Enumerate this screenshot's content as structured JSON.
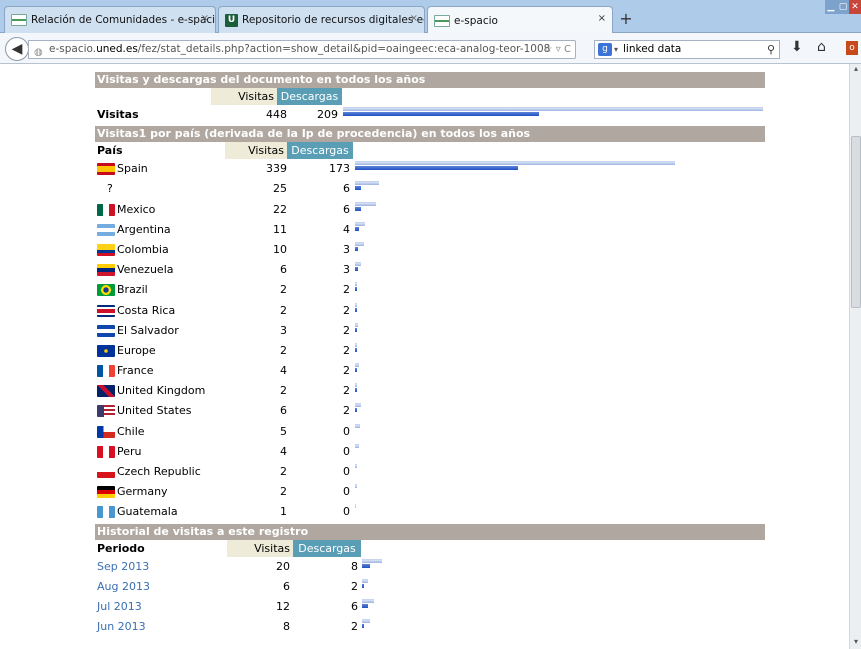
{
  "browser": {
    "tabs": [
      {
        "label": "Relación de Comunidades - e-spacio",
        "icon": "uned-favicon"
      },
      {
        "label": "Repositorio de recursos digitales edu...",
        "icon": "u-favicon"
      },
      {
        "label": "e-spacio",
        "icon": "uned-favicon"
      }
    ],
    "url_prefix": "e-spacio.",
    "url_domain": "uned.es",
    "url_suffix": "/fez/stat_details.php?action=show_detail&pid=oaingeec:eca-analog-teor-1008",
    "search_value": "linked data",
    "new_tab_glyph": "+",
    "close_tab_glyph": "×"
  },
  "section1": {
    "title": "Visitas y descargas del documento en todos los años",
    "col_visits": "Visitas",
    "col_downloads": "Descargas",
    "row_label": "Visitas",
    "visits": 448,
    "downloads": 209
  },
  "section2": {
    "title": "Visitas1 por país (derivada de la Ip de procedencia) en todos los años",
    "col_label": "País",
    "col_visits": "Visitas",
    "col_downloads": "Descargas",
    "rows": [
      {
        "country": "Spain",
        "visits": 339,
        "downloads": 173,
        "flag": "spain"
      },
      {
        "country": "?",
        "visits": 25,
        "downloads": 6,
        "flag": "none"
      },
      {
        "country": "Mexico",
        "visits": 22,
        "downloads": 6,
        "flag": "mexico"
      },
      {
        "country": "Argentina",
        "visits": 11,
        "downloads": 4,
        "flag": "argentina"
      },
      {
        "country": "Colombia",
        "visits": 10,
        "downloads": 3,
        "flag": "colombia"
      },
      {
        "country": "Venezuela",
        "visits": 6,
        "downloads": 3,
        "flag": "venezuela"
      },
      {
        "country": "Brazil",
        "visits": 2,
        "downloads": 2,
        "flag": "brazil"
      },
      {
        "country": "Costa Rica",
        "visits": 2,
        "downloads": 2,
        "flag": "costa-rica"
      },
      {
        "country": "El Salvador",
        "visits": 3,
        "downloads": 2,
        "flag": "el-salvador"
      },
      {
        "country": "Europe",
        "visits": 2,
        "downloads": 2,
        "flag": "europe"
      },
      {
        "country": "France",
        "visits": 4,
        "downloads": 2,
        "flag": "france"
      },
      {
        "country": "United Kingdom",
        "visits": 2,
        "downloads": 2,
        "flag": "uk"
      },
      {
        "country": "United States",
        "visits": 6,
        "downloads": 2,
        "flag": "usa"
      },
      {
        "country": "Chile",
        "visits": 5,
        "downloads": 0,
        "flag": "chile"
      },
      {
        "country": "Peru",
        "visits": 4,
        "downloads": 0,
        "flag": "peru"
      },
      {
        "country": "Czech Republic",
        "visits": 2,
        "downloads": 0,
        "flag": "czech"
      },
      {
        "country": "Germany",
        "visits": 2,
        "downloads": 0,
        "flag": "germany"
      },
      {
        "country": "Guatemala",
        "visits": 1,
        "downloads": 0,
        "flag": "guatemala"
      }
    ]
  },
  "section3": {
    "title": "Historial de visitas a este registro",
    "col_label": "Periodo",
    "col_visits": "Visitas",
    "col_downloads": "Descargas",
    "rows": [
      {
        "period": "Sep 2013",
        "visits": 20,
        "downloads": 8
      },
      {
        "period": "Aug 2013",
        "visits": 6,
        "downloads": 2
      },
      {
        "period": "Jul 2013",
        "visits": 12,
        "downloads": 6
      },
      {
        "period": "Jun 2013",
        "visits": 8,
        "downloads": 2
      }
    ]
  }
}
